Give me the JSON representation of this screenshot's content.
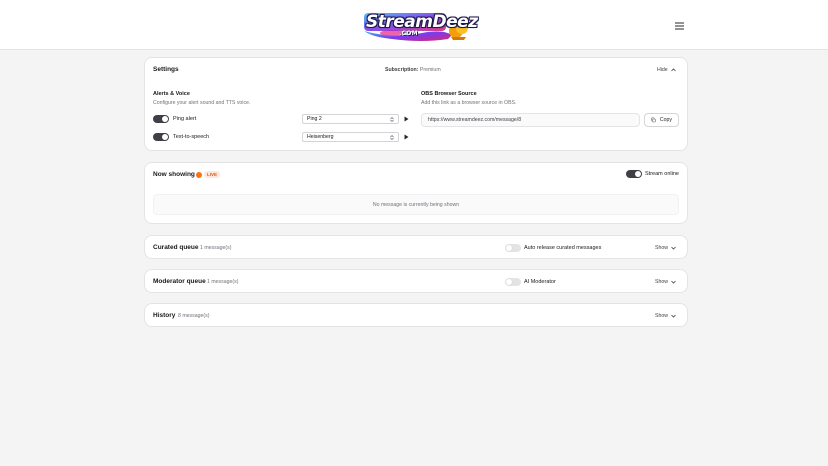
{
  "header": {
    "logo_text": "StreamDeez",
    "logo_sub": ".COM",
    "menu_icon": "hamburger-menu-icon"
  },
  "settings": {
    "title": "Settings",
    "subscription_label": "Subscription:",
    "subscription_value": "Premium",
    "toggle_label": "Hide",
    "alerts": {
      "title": "Alerts & Voice",
      "description": "Configure your alert sound and TTS voice.",
      "ping_label": "Ping alert",
      "ping_enabled": true,
      "ping_sound": "Ping 2",
      "tts_label": "Text-to-speech",
      "tts_enabled": true,
      "tts_voice": "Heisenberg"
    },
    "obs": {
      "title": "OBS Browser Source",
      "description": "Add this link as a browser source in OBS.",
      "url": "https://www.streamdeez.com/message/8",
      "copy_label": "Copy"
    }
  },
  "now_showing": {
    "title": "Now showing",
    "live_label": "LIVE",
    "stream_online_label": "Stream online",
    "stream_online": true,
    "empty_message": "No message is currently being shown"
  },
  "curated_queue": {
    "title": "Curated queue",
    "count": "1 message(s)",
    "auto_release_label": "Auto release curated messages",
    "auto_release": false,
    "toggle_label": "Show"
  },
  "moderator_queue": {
    "title": "Moderator queue",
    "count": "1 message(s)",
    "ai_label": "AI Moderator",
    "ai_enabled": false,
    "toggle_label": "Show"
  },
  "history": {
    "title": "History",
    "count": "8 message(s)",
    "toggle_label": "Show"
  },
  "colors": {
    "live_accent": "#f97316",
    "toggle_on": "#3f3f46",
    "toggle_off": "#e4e4e7",
    "background": "#f4f4f5"
  }
}
